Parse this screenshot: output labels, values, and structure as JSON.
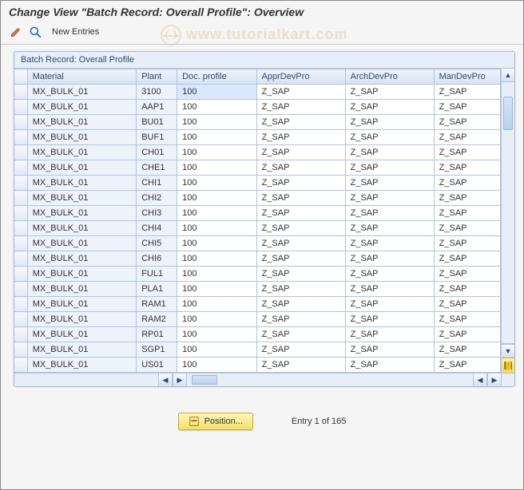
{
  "titlebar": "Change View \"Batch Record: Overall Profile\": Overview",
  "toolbar": {
    "new_entries": "New Entries"
  },
  "watermark": "www.tutorialkart.com",
  "table": {
    "caption": "Batch Record: Overall Profile",
    "columns": {
      "material": "Material",
      "plant": "Plant",
      "doc_profile": "Doc. profile",
      "appr": "ApprDevPro",
      "arch": "ArchDevPro",
      "man": "ManDevPro"
    },
    "rows": [
      {
        "material": "MX_BULK_01",
        "plant": "3100",
        "doc": "100",
        "appr": "Z_SAP",
        "arch": "Z_SAP",
        "man": "Z_SAP"
      },
      {
        "material": "MX_BULK_01",
        "plant": "AAP1",
        "doc": "100",
        "appr": "Z_SAP",
        "arch": "Z_SAP",
        "man": "Z_SAP"
      },
      {
        "material": "MX_BULK_01",
        "plant": "BU01",
        "doc": "100",
        "appr": "Z_SAP",
        "arch": "Z_SAP",
        "man": "Z_SAP"
      },
      {
        "material": "MX_BULK_01",
        "plant": "BUF1",
        "doc": "100",
        "appr": "Z_SAP",
        "arch": "Z_SAP",
        "man": "Z_SAP"
      },
      {
        "material": "MX_BULK_01",
        "plant": "CH01",
        "doc": "100",
        "appr": "Z_SAP",
        "arch": "Z_SAP",
        "man": "Z_SAP"
      },
      {
        "material": "MX_BULK_01",
        "plant": "CHE1",
        "doc": "100",
        "appr": "Z_SAP",
        "arch": "Z_SAP",
        "man": "Z_SAP"
      },
      {
        "material": "MX_BULK_01",
        "plant": "CHI1",
        "doc": "100",
        "appr": "Z_SAP",
        "arch": "Z_SAP",
        "man": "Z_SAP"
      },
      {
        "material": "MX_BULK_01",
        "plant": "CHI2",
        "doc": "100",
        "appr": "Z_SAP",
        "arch": "Z_SAP",
        "man": "Z_SAP"
      },
      {
        "material": "MX_BULK_01",
        "plant": "CHI3",
        "doc": "100",
        "appr": "Z_SAP",
        "arch": "Z_SAP",
        "man": "Z_SAP"
      },
      {
        "material": "MX_BULK_01",
        "plant": "CHI4",
        "doc": "100",
        "appr": "Z_SAP",
        "arch": "Z_SAP",
        "man": "Z_SAP"
      },
      {
        "material": "MX_BULK_01",
        "plant": "CHI5",
        "doc": "100",
        "appr": "Z_SAP",
        "arch": "Z_SAP",
        "man": "Z_SAP"
      },
      {
        "material": "MX_BULK_01",
        "plant": "CHI6",
        "doc": "100",
        "appr": "Z_SAP",
        "arch": "Z_SAP",
        "man": "Z_SAP"
      },
      {
        "material": "MX_BULK_01",
        "plant": "FUL1",
        "doc": "100",
        "appr": "Z_SAP",
        "arch": "Z_SAP",
        "man": "Z_SAP"
      },
      {
        "material": "MX_BULK_01",
        "plant": "PLA1",
        "doc": "100",
        "appr": "Z_SAP",
        "arch": "Z_SAP",
        "man": "Z_SAP"
      },
      {
        "material": "MX_BULK_01",
        "plant": "RAM1",
        "doc": "100",
        "appr": "Z_SAP",
        "arch": "Z_SAP",
        "man": "Z_SAP"
      },
      {
        "material": "MX_BULK_01",
        "plant": "RAM2",
        "doc": "100",
        "appr": "Z_SAP",
        "arch": "Z_SAP",
        "man": "Z_SAP"
      },
      {
        "material": "MX_BULK_01",
        "plant": "RP01",
        "doc": "100",
        "appr": "Z_SAP",
        "arch": "Z_SAP",
        "man": "Z_SAP"
      },
      {
        "material": "MX_BULK_01",
        "plant": "SGP1",
        "doc": "100",
        "appr": "Z_SAP",
        "arch": "Z_SAP",
        "man": "Z_SAP"
      },
      {
        "material": "MX_BULK_01",
        "plant": "US01",
        "doc": "100",
        "appr": "Z_SAP",
        "arch": "Z_SAP",
        "man": "Z_SAP"
      }
    ]
  },
  "footer": {
    "position_label": "Position...",
    "entry_status": "Entry 1 of 165"
  }
}
